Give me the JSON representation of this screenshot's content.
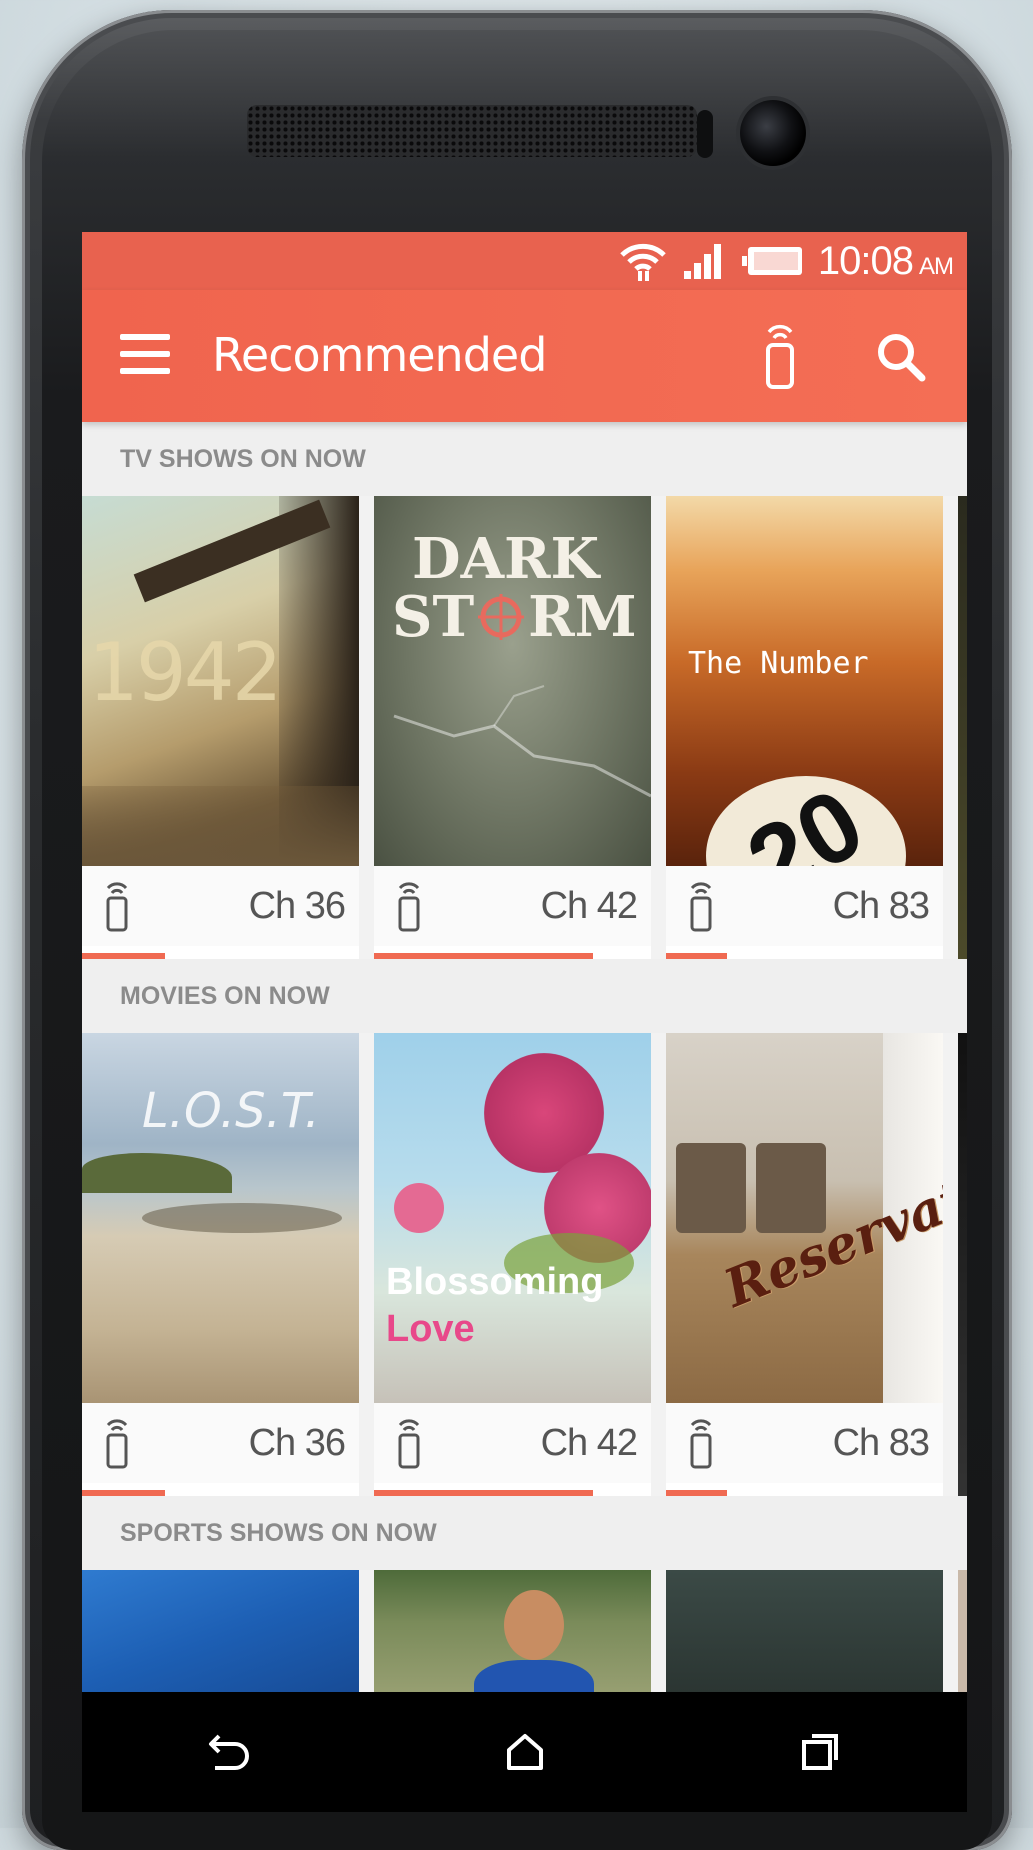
{
  "status_bar": {
    "time": "10:08",
    "ampm": "AM",
    "icons": [
      "wifi-icon",
      "signal-icon",
      "battery-icon"
    ]
  },
  "app_bar": {
    "title": "Recommended",
    "icons": [
      "menu-icon",
      "remote-icon",
      "search-icon"
    ]
  },
  "sections": [
    {
      "header": "TV SHOWS ON NOW",
      "cards": [
        {
          "title": "1942",
          "channel": "Ch 36",
          "progress": 0.3
        },
        {
          "title": "DARK STORM",
          "channel": "Ch 42",
          "progress": 0.79
        },
        {
          "title": "The Number",
          "channel": "Ch 83",
          "progress": 0.22
        }
      ]
    },
    {
      "header": "MOVIES ON NOW",
      "cards": [
        {
          "title": "L.O.S.T.",
          "channel": "Ch 36",
          "progress": 0.3
        },
        {
          "title": "Blossoming Love",
          "channel": "Ch 42",
          "progress": 0.79
        },
        {
          "title": "Reservation",
          "channel": "Ch 83",
          "progress": 0.22
        }
      ]
    },
    {
      "header": "SPORTS SHOWS ON NOW",
      "cards": []
    }
  ],
  "art_text": {
    "t1942": "1942",
    "dark": "DARK",
    "storm_st": "ST",
    "storm_rm": "RM",
    "number_title": "The Number",
    "number_badge": "20",
    "lost": "L.O.S.T.",
    "blossoming": "Blossoming",
    "love": "Love",
    "reservation": "Reservation"
  },
  "nav": [
    "back-icon",
    "home-icon",
    "recents-icon"
  ],
  "colors": {
    "accent": "#f0644e",
    "status_bar": "#e8624f",
    "progress": "#f06a52"
  }
}
